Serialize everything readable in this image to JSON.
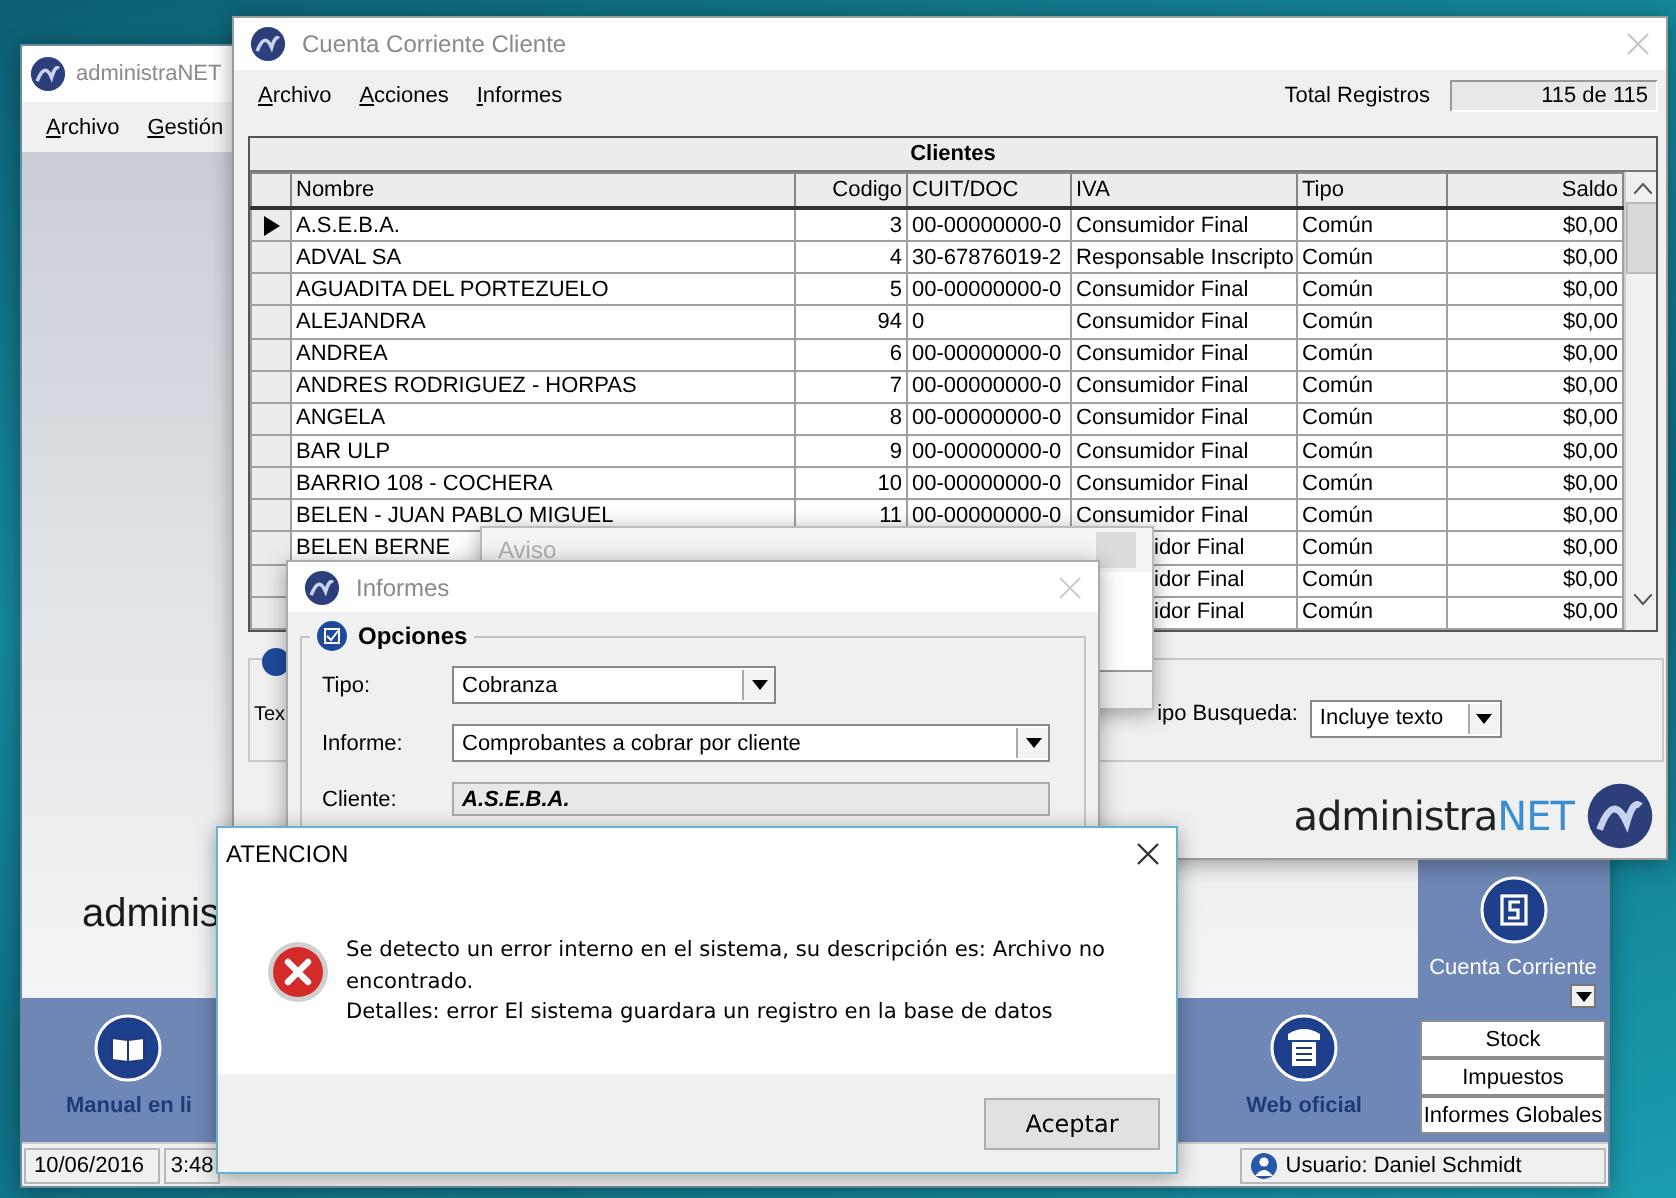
{
  "main_window": {
    "title": "administraNET",
    "menu": [
      "Archivo",
      "Gestión"
    ],
    "logo_text": "adminis",
    "shortcuts": [
      {
        "kind": "book",
        "label": "Manual en li"
      },
      {
        "kind": "web",
        "label": "Web oficial"
      }
    ],
    "side_panel": {
      "tile": {
        "kind": "bill",
        "label": "Cuenta Corriente"
      },
      "buttons": [
        "Stock",
        "Impuestos",
        "Informes Globales"
      ]
    },
    "status_bar": {
      "date": "10/06/2016",
      "time": "3:48",
      "user": "Usuario: Daniel Schmidt"
    }
  },
  "account_window": {
    "title": "Cuenta Corriente Cliente",
    "menu": [
      "Archivo",
      "Acciones",
      "Informes"
    ],
    "total_label": "Total Registros",
    "total_value": "115 de 115",
    "table": {
      "title": "Clientes",
      "columns": [
        "Nombre",
        "Codigo",
        "CUIT/DOC",
        "IVA",
        "Tipo",
        "Saldo"
      ],
      "rows": [
        {
          "selected": true,
          "covered": false,
          "nombre": "A.S.E.B.A.",
          "codigo": "3",
          "cuit": "00-00000000-0",
          "iva": "Consumidor Final",
          "tipo": "Común",
          "saldo": "$0,00"
        },
        {
          "selected": false,
          "covered": false,
          "nombre": "ADVAL SA",
          "codigo": "4",
          "cuit": "30-67876019-2",
          "iva": "Responsable Inscripto",
          "tipo": "Común",
          "saldo": "$0,00"
        },
        {
          "selected": false,
          "covered": false,
          "nombre": "AGUADITA DEL PORTEZUELO",
          "codigo": "5",
          "cuit": "00-00000000-0",
          "iva": "Consumidor Final",
          "tipo": "Común",
          "saldo": "$0,00"
        },
        {
          "selected": false,
          "covered": false,
          "nombre": "ALEJANDRA",
          "codigo": "94",
          "cuit": "0",
          "iva": "Consumidor Final",
          "tipo": "Común",
          "saldo": "$0,00"
        },
        {
          "selected": false,
          "covered": false,
          "nombre": "ANDREA",
          "codigo": "6",
          "cuit": "00-00000000-0",
          "iva": "Consumidor Final",
          "tipo": "Común",
          "saldo": "$0,00"
        },
        {
          "selected": false,
          "covered": false,
          "nombre": "ANDRES RODRIGUEZ - HORPAS",
          "codigo": "7",
          "cuit": "00-00000000-0",
          "iva": "Consumidor Final",
          "tipo": "Común",
          "saldo": "$0,00"
        },
        {
          "selected": false,
          "covered": false,
          "nombre": "ANGELA",
          "codigo": "8",
          "cuit": "00-00000000-0",
          "iva": "Consumidor Final",
          "tipo": "Común",
          "saldo": "$0,00"
        },
        {
          "selected": false,
          "covered": false,
          "nombre": "BAR ULP",
          "codigo": "9",
          "cuit": "00-00000000-0",
          "iva": "Consumidor Final",
          "tipo": "Común",
          "saldo": "$0,00"
        },
        {
          "selected": false,
          "covered": false,
          "nombre": "BARRIO 108 - COCHERA",
          "codigo": "10",
          "cuit": "00-00000000-0",
          "iva": "Consumidor Final",
          "tipo": "Común",
          "saldo": "$0,00"
        },
        {
          "selected": false,
          "covered": false,
          "nombre": "BELEN - JUAN PABLO MIGUEL",
          "codigo": "11",
          "cuit": "00-00000000-0",
          "iva": "Consumidor Final",
          "tipo": "Común",
          "saldo": "$0,00"
        },
        {
          "selected": false,
          "covered": true,
          "nombre": "BELEN BERNE",
          "iva": "idor Final",
          "tipo": "Común",
          "saldo": "$0,00"
        },
        {
          "selected": false,
          "covered": true,
          "iva": "idor Final",
          "tipo": "Común",
          "saldo": "$0,00"
        },
        {
          "selected": false,
          "covered": true,
          "iva": "idor Final",
          "tipo": "Común",
          "saldo": "$0,00"
        }
      ]
    },
    "search": {
      "text_label": "Tex",
      "type_label": "ipo Busqueda:",
      "type_value": "Incluye texto"
    },
    "logo": {
      "prefix": "administra",
      "suffix": "NET"
    }
  },
  "notice_window": {
    "title": "Aviso"
  },
  "report_window": {
    "title": "Informes",
    "group": "Opciones",
    "fields": [
      {
        "kind": "combo",
        "label": "Tipo:",
        "value": "Cobranza"
      },
      {
        "kind": "wide_combo",
        "label": "Informe:",
        "value": "Comprobantes a cobrar por cliente"
      },
      {
        "kind": "readonly",
        "label": "Cliente:",
        "value": "A.S.E.B.A."
      }
    ]
  },
  "alert_dialog": {
    "title": "ATENCION",
    "lines": [
      "Se detecto un error interno en el sistema, su descripción es: Archivo no encontrado.",
      "Detalles: error El sistema guardara un registro en la base de datos"
    ],
    "button": "Aceptar"
  }
}
